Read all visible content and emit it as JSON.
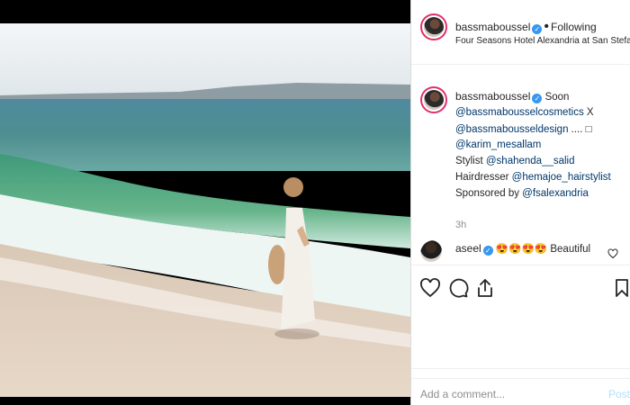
{
  "post": {
    "author": "bassmaboussel",
    "follow_label": "Following",
    "location": "Four Seasons Hotel Alexandria at San Stefano,..."
  },
  "caption": {
    "author": "bassmaboussel",
    "line1_rest": "Soon",
    "line2_mention": "@bassmabousselcosmetics",
    "line2_rest": " X",
    "line3_mention": "@bassmabousseldesign",
    "line3_rest": " .... □",
    "line4_mention": "@karim_mesallam",
    "line5_prefix": "Stylist ",
    "line5_mention": "@shahenda__salid",
    "line6_prefix": "Hairdresser ",
    "line6_mention": "@hemajoe_hairstylist",
    "line7_prefix": "Sponsored by ",
    "line7_mention": "@fsalexandria",
    "time": "3h"
  },
  "comment": {
    "author": "aseel",
    "text": "😍😍😍😍 Beautiful"
  },
  "composer": {
    "placeholder": "Add a comment...",
    "post_label": "Post"
  },
  "icons": {
    "like": "heart-icon",
    "comment": "comment-icon",
    "share": "share-icon",
    "save": "bookmark-icon",
    "verified": "verified-badge-icon"
  },
  "colors": {
    "link": "#00376b",
    "verified": "#3897f0",
    "ring": "#e1306c",
    "post_disabled": "#b2dffc"
  }
}
